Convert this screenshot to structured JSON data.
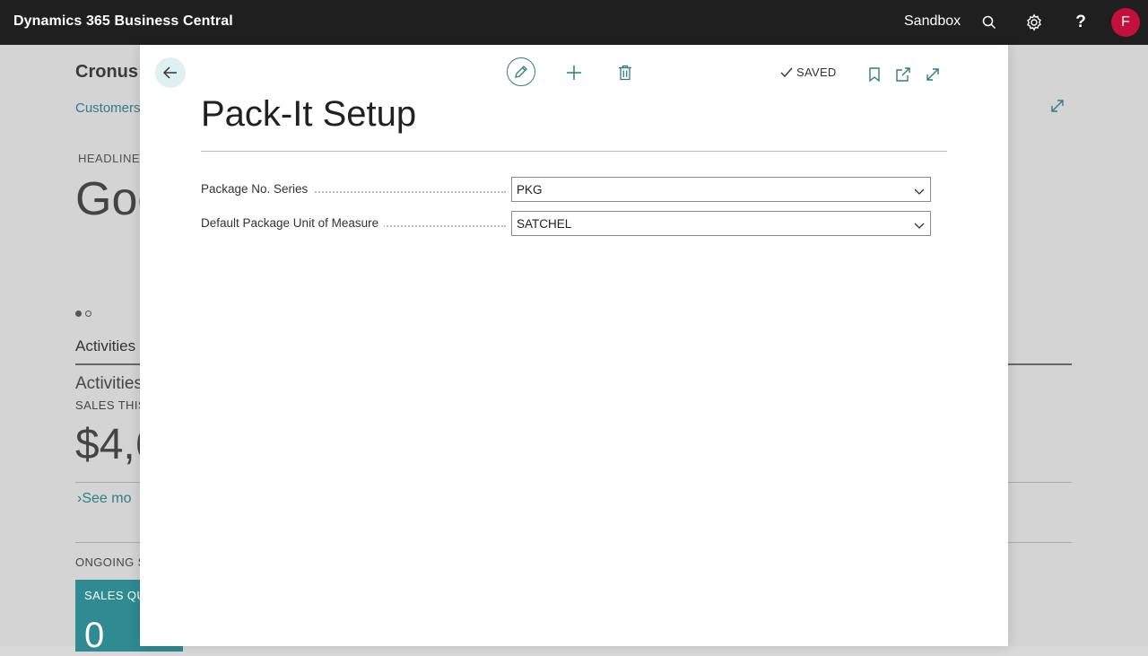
{
  "app": {
    "title": "Dynamics 365 Business Central",
    "environment": "Sandbox",
    "user_initial": "F",
    "avatar_color": "#c4103c"
  },
  "background": {
    "company": "Cronus",
    "nav_item": "Customers",
    "headline_label": "HEADLINE",
    "headline_text": "Goo",
    "activities_title": "Activities",
    "activities_sub": "Activities",
    "sales_label": "SALES THIS",
    "sales_amount": "$4,6",
    "see_more": "See mo",
    "ongoing_label": "ONGOING S",
    "tile_label": "SALES QU",
    "tile_value": "0"
  },
  "dialog": {
    "status": "SAVED",
    "title": "Pack-It Setup",
    "fields": [
      {
        "label": "Package No. Series",
        "value": "PKG"
      },
      {
        "label": "Default Package Unit of Measure",
        "value": "SATCHEL"
      }
    ]
  },
  "colors": {
    "accent": "#2f7d85",
    "appbar": "#1f1f1f"
  }
}
